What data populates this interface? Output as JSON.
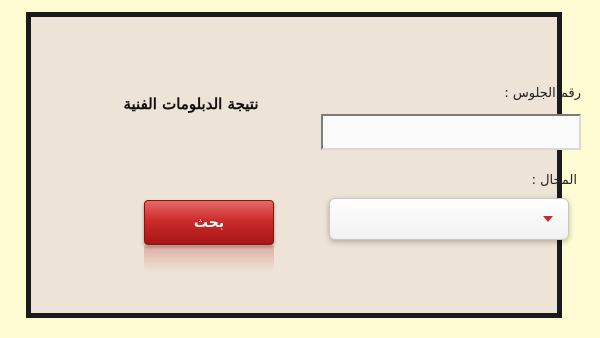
{
  "form": {
    "title": "نتيجة الدبلومات الفنية",
    "seat_number_label": "رقم الجلوس :",
    "seat_number_value": "",
    "field_label": "المجال :",
    "field_selected": "",
    "search_button_label": "بحث"
  },
  "icons": {
    "dropdown": "chevron-down-icon"
  },
  "colors": {
    "page_background": "#fdfcd3",
    "panel_background": "#ede3d6",
    "button_red": "#cc2b2b",
    "frame_border": "#1a1a1a"
  }
}
